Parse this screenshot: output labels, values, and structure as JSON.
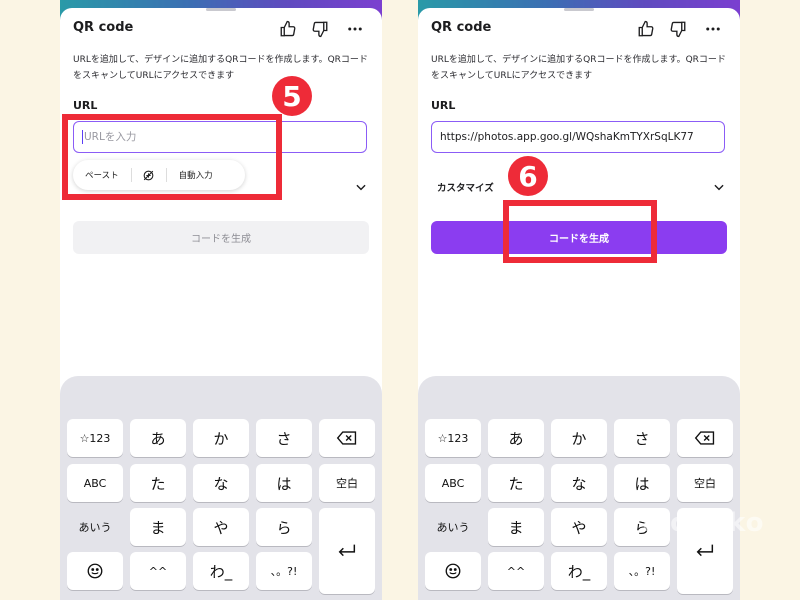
{
  "left": {
    "header_title": "QR code",
    "description": "URLを追加して、デザインに追加するQRコードを作成します。QRコードをスキャンしてURLにアクセスできます",
    "url_label": "URL",
    "url_placeholder": "URLを入力",
    "paste_label": "ペースト",
    "autofill_label": "自動入力",
    "generate_label": "コードを生成",
    "step": "5"
  },
  "right": {
    "header_title": "QR code",
    "description": "URLを追加して、デザインに追加するQRコードを作成します。QRコードをスキャンしてURLにアクセスできます",
    "url_label": "URL",
    "url_value": "https://photos.app.goo.gl/WQshaKmTYXrSqLK77",
    "customize_label": "カスタマイズ",
    "generate_label": "コードを生成",
    "step": "6"
  },
  "keyboard": {
    "keys": [
      "☆123",
      "あ",
      "か",
      "さ",
      "ABC",
      "た",
      "な",
      "は",
      "空白",
      "あいう",
      "ま",
      "や",
      "ら",
      "^^",
      "わ_",
      "、。?!"
    ]
  },
  "watermark": "monnko",
  "colors": {
    "accent": "#8b3df0",
    "highlight": "#ee2b38",
    "background": "#fbf5e4"
  },
  "icons": [
    "thumbs-up-icon",
    "thumbs-down-icon",
    "more-icon",
    "chevron-down-icon",
    "backspace-icon",
    "enter-icon",
    "emoji-icon",
    "autofill-icon"
  ]
}
